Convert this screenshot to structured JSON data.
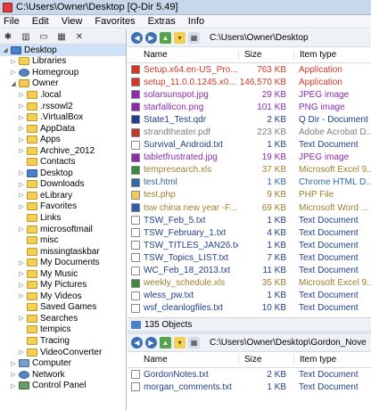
{
  "window": {
    "title": "C:\\Users\\Owner\\Desktop  [Q-Dir 5.49]"
  },
  "menu": [
    "File",
    "Edit",
    "View",
    "Favorites",
    "Extras",
    "Info"
  ],
  "tree": [
    {
      "label": "Desktop",
      "indent": 0,
      "icon": "blue",
      "expander": "◢",
      "selected": true
    },
    {
      "label": "Libraries",
      "indent": 1,
      "icon": "folder",
      "expander": "▷"
    },
    {
      "label": "Homegroup",
      "indent": 1,
      "icon": "net",
      "expander": "▷"
    },
    {
      "label": "Owner",
      "indent": 1,
      "icon": "user",
      "expander": "◢"
    },
    {
      "label": ".local",
      "indent": 2,
      "icon": "folder",
      "expander": "▷"
    },
    {
      "label": ".rssowl2",
      "indent": 2,
      "icon": "folder",
      "expander": "▷"
    },
    {
      "label": ".VirtualBox",
      "indent": 2,
      "icon": "folder",
      "expander": "▷"
    },
    {
      "label": "AppData",
      "indent": 2,
      "icon": "folder",
      "expander": "▷"
    },
    {
      "label": "Apps",
      "indent": 2,
      "icon": "folder",
      "expander": "▷"
    },
    {
      "label": "Archive_2012",
      "indent": 2,
      "icon": "folder",
      "expander": "▷"
    },
    {
      "label": "Contacts",
      "indent": 2,
      "icon": "folder",
      "expander": ""
    },
    {
      "label": "Desktop",
      "indent": 2,
      "icon": "blue",
      "expander": "▷"
    },
    {
      "label": "Downloads",
      "indent": 2,
      "icon": "folder",
      "expander": "▷"
    },
    {
      "label": "eLibrary",
      "indent": 2,
      "icon": "folder",
      "expander": "▷"
    },
    {
      "label": "Favorites",
      "indent": 2,
      "icon": "folder",
      "expander": "▷"
    },
    {
      "label": "Links",
      "indent": 2,
      "icon": "folder",
      "expander": ""
    },
    {
      "label": "microsoftmail",
      "indent": 2,
      "icon": "folder",
      "expander": "▷"
    },
    {
      "label": "misc",
      "indent": 2,
      "icon": "folder",
      "expander": ""
    },
    {
      "label": "missingtaskbar",
      "indent": 2,
      "icon": "folder",
      "expander": ""
    },
    {
      "label": "My Documents",
      "indent": 2,
      "icon": "folder",
      "expander": "▷"
    },
    {
      "label": "My Music",
      "indent": 2,
      "icon": "folder",
      "expander": "▷"
    },
    {
      "label": "My Pictures",
      "indent": 2,
      "icon": "folder",
      "expander": "▷"
    },
    {
      "label": "My Videos",
      "indent": 2,
      "icon": "folder",
      "expander": "▷"
    },
    {
      "label": "Saved Games",
      "indent": 2,
      "icon": "folder",
      "expander": ""
    },
    {
      "label": "Searches",
      "indent": 2,
      "icon": "folder",
      "expander": "▷"
    },
    {
      "label": "tempics",
      "indent": 2,
      "icon": "folder",
      "expander": ""
    },
    {
      "label": "Tracing",
      "indent": 2,
      "icon": "folder",
      "expander": ""
    },
    {
      "label": "VideoConverter",
      "indent": 2,
      "icon": "folder",
      "expander": "▷"
    },
    {
      "label": "Computer",
      "indent": 1,
      "icon": "comp",
      "expander": "▷"
    },
    {
      "label": "Network",
      "indent": 1,
      "icon": "net",
      "expander": "▷"
    },
    {
      "label": "Control Panel",
      "indent": 1,
      "icon": "cp",
      "expander": "▷"
    }
  ],
  "top_pane": {
    "address": "C:\\Users\\Owner\\Desktop",
    "columns": {
      "name": "Name",
      "size": "Size",
      "type": "Item type"
    },
    "files": [
      {
        "name": "Setup.x64.en-US_Pro...",
        "size": "763 KB",
        "type": "Application",
        "color": "#d0382a",
        "icon": "#d0382a"
      },
      {
        "name": "setup_11.0.0.1245.x0...",
        "size": "146,570 KB",
        "type": "Application",
        "color": "#d0382a",
        "icon": "#d0382a"
      },
      {
        "name": "solarsunspot.jpg",
        "size": "29 KB",
        "type": "JPEG image",
        "color": "#8a2bb0",
        "icon": "#8a2bb0"
      },
      {
        "name": "starfallicon.png",
        "size": "101 KB",
        "type": "PNG image",
        "color": "#8a2bb0",
        "icon": "#8a2bb0"
      },
      {
        "name": "State1_Test.qdr",
        "size": "2 KB",
        "type": "Q Dir - Document",
        "color": "#1f3f8a",
        "icon": "#1f3f8a"
      },
      {
        "name": "strandtheater.pdf",
        "size": "223 KB",
        "type": "Adobe Acrobat D...",
        "color": "#7f7f7f",
        "icon": "#c0392b"
      },
      {
        "name": "Survival_Android.txt",
        "size": "1 KB",
        "type": "Text Document",
        "color": "#1f3f8a",
        "icon": "#ffffff"
      },
      {
        "name": "tabletfrustrated.jpg",
        "size": "19 KB",
        "type": "JPEG image",
        "color": "#8a2bb0",
        "icon": "#8a2bb0"
      },
      {
        "name": "tempresearch.xls",
        "size": "37 KB",
        "type": "Microsoft Excel 9...",
        "color": "#a08030",
        "icon": "#3d8a3d"
      },
      {
        "name": "test.html",
        "size": "1 KB",
        "type": "Chrome HTML D...",
        "color": "#2e6aa8",
        "icon": "#2e6aa8"
      },
      {
        "name": "test.php",
        "size": "9 KB",
        "type": "PHP File",
        "color": "#a08030",
        "icon": "#f0c85a"
      },
      {
        "name": "tsw china new year -F...",
        "size": "69 KB",
        "type": "Microsoft Word ...",
        "color": "#a08030",
        "icon": "#2e5aa8"
      },
      {
        "name": "TSW_Feb_5.txt",
        "size": "1 KB",
        "type": "Text Document",
        "color": "#1f3f8a",
        "icon": "#ffffff"
      },
      {
        "name": "TSW_February_1.txt",
        "size": "4 KB",
        "type": "Text Document",
        "color": "#1f3f8a",
        "icon": "#ffffff"
      },
      {
        "name": "TSW_TITLES_JAN26.txt",
        "size": "1 KB",
        "type": "Text Document",
        "color": "#1f3f8a",
        "icon": "#ffffff"
      },
      {
        "name": "TSW_Topics_LIST.txt",
        "size": "7 KB",
        "type": "Text Document",
        "color": "#1f3f8a",
        "icon": "#ffffff"
      },
      {
        "name": "WC_Feb_18_2013.txt",
        "size": "11 KB",
        "type": "Text Document",
        "color": "#1f3f8a",
        "icon": "#ffffff"
      },
      {
        "name": "weekly_schedule.xls",
        "size": "35 KB",
        "type": "Microsoft Excel 9...",
        "color": "#a08030",
        "icon": "#3d8a3d"
      },
      {
        "name": "wless_pw.txt",
        "size": "1 KB",
        "type": "Text Document",
        "color": "#1f3f8a",
        "icon": "#ffffff"
      },
      {
        "name": "wsf_cleanlogfiles.txt",
        "size": "10 KB",
        "type": "Text Document",
        "color": "#1f3f8a",
        "icon": "#ffffff"
      }
    ],
    "status": "135 Objects"
  },
  "bottom_pane": {
    "address": "C:\\Users\\Owner\\Desktop\\Gordon_Nove",
    "columns": {
      "name": "Name",
      "size": "Size",
      "type": "Item type"
    },
    "files": [
      {
        "name": "GordonNotes.txt",
        "size": "2 KB",
        "type": "Text Document",
        "color": "#1f3f8a",
        "icon": "#ffffff"
      },
      {
        "name": "morgan_comments.txt",
        "size": "1 KB",
        "type": "Text Document",
        "color": "#1f3f8a",
        "icon": "#ffffff"
      }
    ]
  }
}
